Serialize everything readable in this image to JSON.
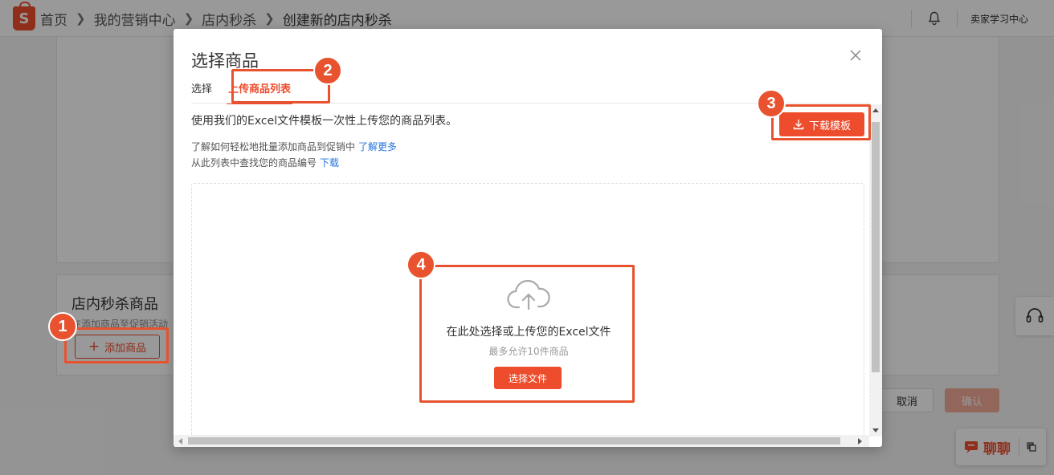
{
  "colors": {
    "brand": "#ee4d2d",
    "link": "#2673dd",
    "annotation": "#e8522f"
  },
  "header": {
    "logo_icon": "shopee-bag-icon",
    "breadcrumbs": [
      "首页",
      "我的营销中心",
      "店内秒杀",
      "创建新的店内秒杀"
    ],
    "learning_center": "卖家学习中心"
  },
  "page": {
    "products_section": {
      "title": "店内秒杀商品",
      "subtitle": "在添加商品至促销活动",
      "add_button": "添加商品"
    },
    "cancel_label": "取消",
    "confirm_label": "确认",
    "chat_label": "聊聊"
  },
  "modal": {
    "title": "选择商品",
    "tabs": [
      "选择",
      "上传商品列表"
    ],
    "active_tab": 1,
    "lead": "使用我们的Excel文件模板一次性上传您的商品列表。",
    "hint1": {
      "text": "了解如何轻松地批量添加商品到促销中",
      "link": "了解更多"
    },
    "hint2": {
      "text": "从此列表中查找您的商品编号",
      "link": "下载"
    },
    "download_template": "下载模板",
    "dropzone": {
      "main": "在此处选择或上传您的Excel文件",
      "sub": "最多允许10件商品",
      "choose_button": "选择文件"
    }
  },
  "annotations": [
    "1",
    "2",
    "3",
    "4"
  ]
}
